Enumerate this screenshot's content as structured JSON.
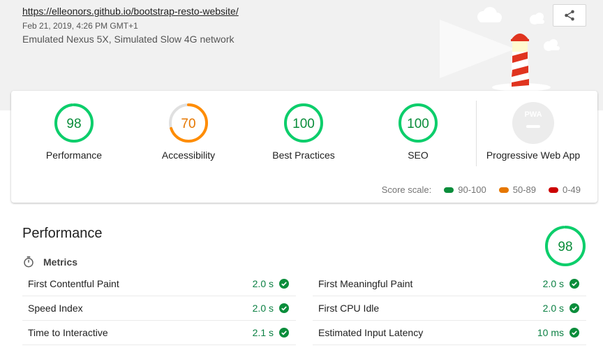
{
  "header": {
    "url": "https://elleonors.github.io/bootstrap-resto-website/",
    "fetch_time": "Feb 21, 2019, 4:26 PM GMT+1",
    "environment": "Emulated Nexus 5X, Simulated Slow 4G network",
    "share_icon": "share-icon"
  },
  "categories": [
    {
      "label": "Performance",
      "score": "98",
      "color": "#0cce6b"
    },
    {
      "label": "Accessibility",
      "score": "70",
      "color": "#ff8c00"
    },
    {
      "label": "Best Practices",
      "score": "100",
      "color": "#0cce6b"
    },
    {
      "label": "SEO",
      "score": "100",
      "color": "#0cce6b"
    },
    {
      "label": "Progressive Web App",
      "badge": "PWA",
      "color": "#c8c8c8"
    }
  ],
  "scale": {
    "label": "Score scale:",
    "ranges": [
      {
        "label": "90-100",
        "color": "#0cce6b"
      },
      {
        "label": "50-89",
        "color": "#ff8c00"
      },
      {
        "label": "0-49",
        "color": "#ff1800"
      }
    ]
  },
  "performance": {
    "title": "Performance",
    "score": "98",
    "metrics_label": "Metrics",
    "metrics": [
      {
        "name": "First Contentful Paint",
        "value": "2.0 s"
      },
      {
        "name": "First Meaningful Paint",
        "value": "2.0 s"
      },
      {
        "name": "Speed Index",
        "value": "2.0 s"
      },
      {
        "name": "First CPU Idle",
        "value": "2.0 s"
      },
      {
        "name": "Time to Interactive",
        "value": "2.1 s"
      },
      {
        "name": "Estimated Input Latency",
        "value": "10 ms"
      }
    ]
  }
}
